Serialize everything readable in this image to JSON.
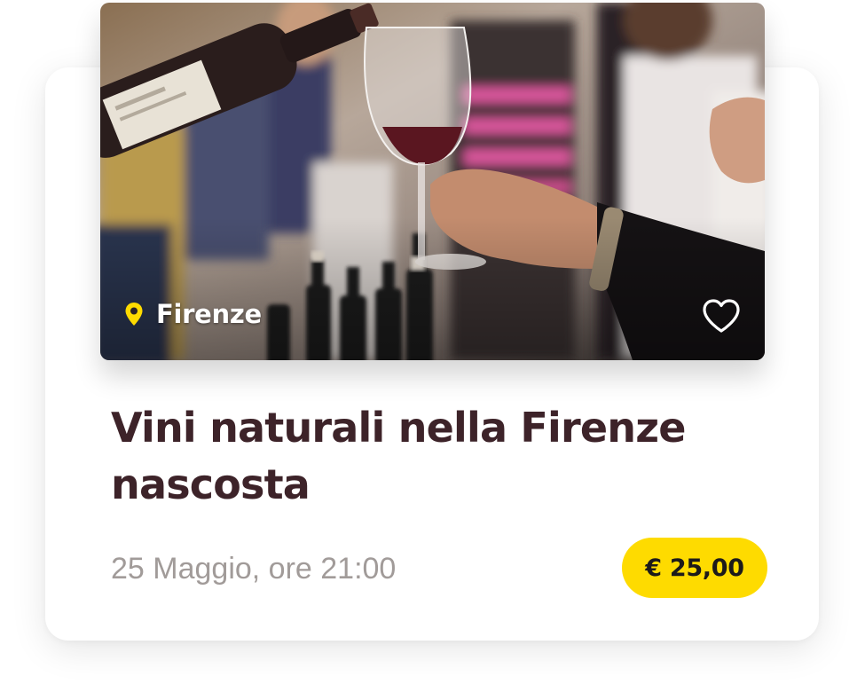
{
  "event": {
    "location": "Firenze",
    "title": "Vini naturali nella Firenze nascosta",
    "date": "25 Maggio, ore 21:00",
    "price": "€ 25,00",
    "favorited": false
  },
  "icons": {
    "location": "map-pin-icon",
    "favorite": "heart-icon"
  },
  "colors": {
    "title": "#3d2329",
    "date": "#a19b99",
    "price_badge": "#fedb00",
    "pin": "#fedb00"
  }
}
